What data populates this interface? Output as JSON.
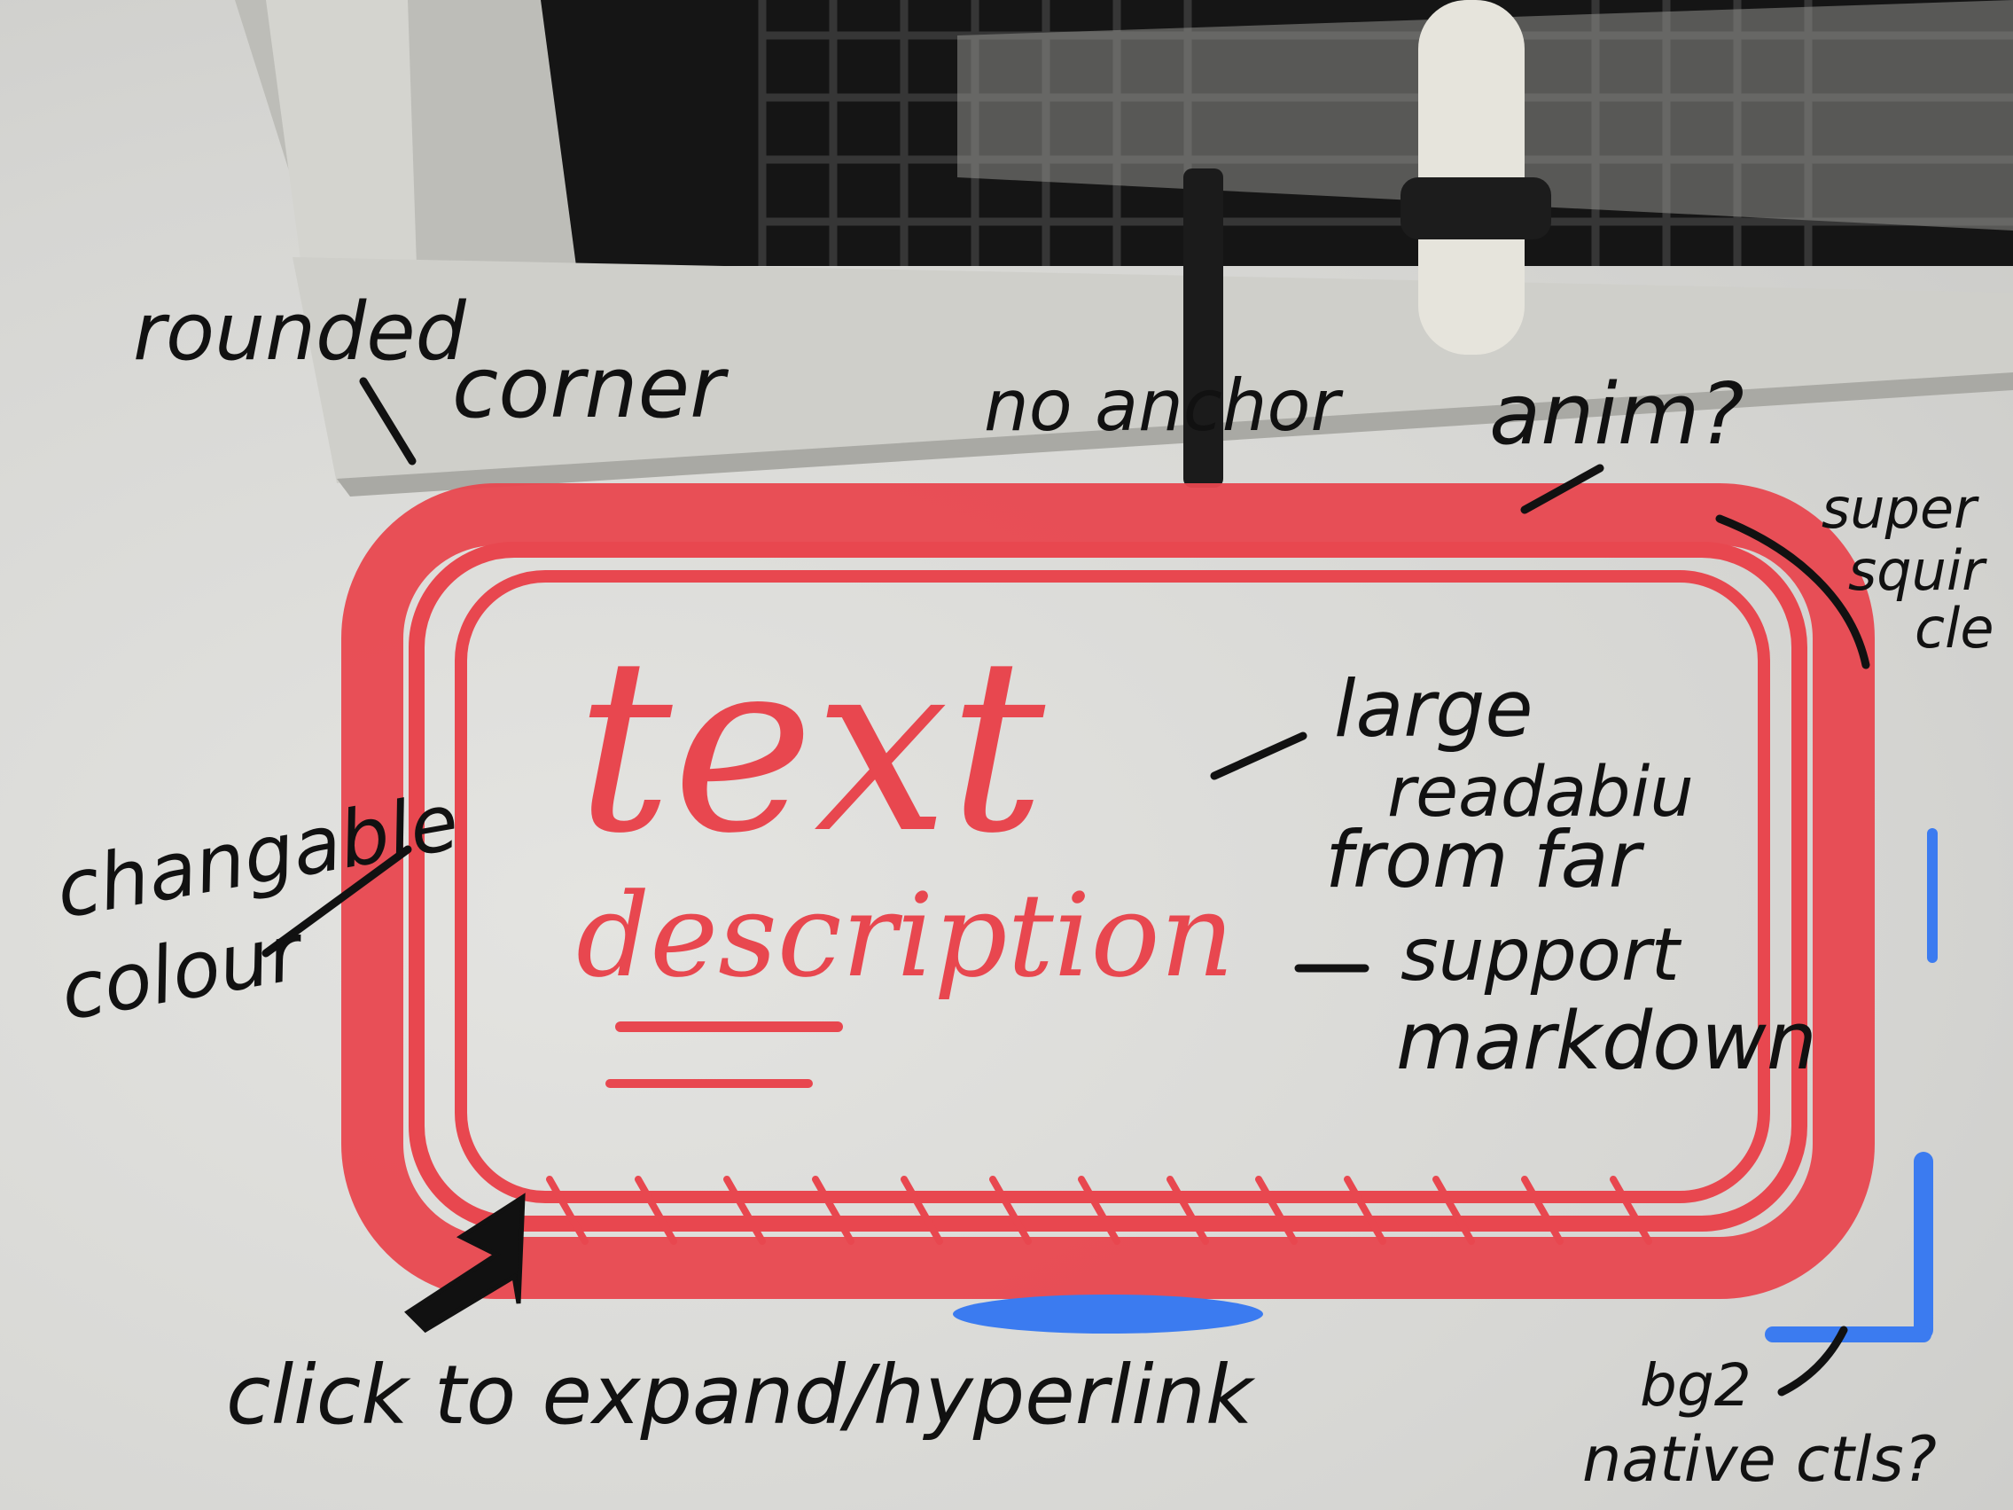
{
  "annotations": {
    "rounded": "rounded",
    "corner": "corner",
    "no_anchor": "no anchor",
    "anim": "anim?",
    "super": "super",
    "squircle_1": "squir",
    "squircle_2": "cle",
    "large": "large",
    "readability": "readabiu",
    "from_far": "from far",
    "support": "support",
    "markdown": "markdown",
    "changeable": "changable",
    "colour": "colour",
    "click": "click to expand/hyperlink",
    "bg2": "bg2",
    "native": "native ctls?"
  },
  "card": {
    "title": "text",
    "description": "description"
  },
  "colors": {
    "card_stroke": "#e8474f",
    "accent_blue": "#3b7bf0",
    "ink": "#111111"
  }
}
